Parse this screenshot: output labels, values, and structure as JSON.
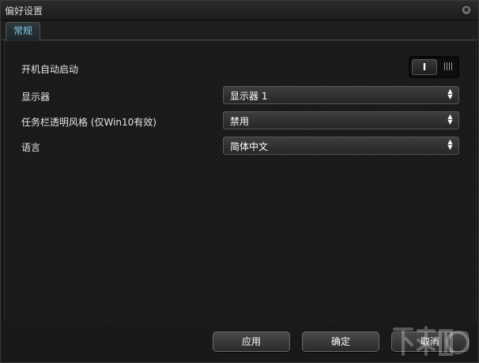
{
  "window": {
    "title": "偏好设置"
  },
  "tabs": [
    {
      "label": "常规",
      "active": true
    }
  ],
  "settings": {
    "autostart": {
      "label": "开机自动启动",
      "on_label": "I",
      "enabled": true
    },
    "monitor": {
      "label": "显示器",
      "value": "显示器 1"
    },
    "taskbar": {
      "label": "任务栏透明风格 (仅Win10有效)",
      "value": "禁用"
    },
    "language": {
      "label": "语言",
      "value": "简体中文"
    }
  },
  "footer": {
    "apply_label": "应用",
    "ok_label": "确定",
    "cancel_label": "取消"
  },
  "colors": {
    "accent_tab_text": "#7ec9e8",
    "background": "#1b1b1b"
  },
  "icons": {
    "close": "close-icon",
    "select_arrows": "up-down-arrows-icon",
    "toggle_grip": "grip-lines-icon"
  }
}
